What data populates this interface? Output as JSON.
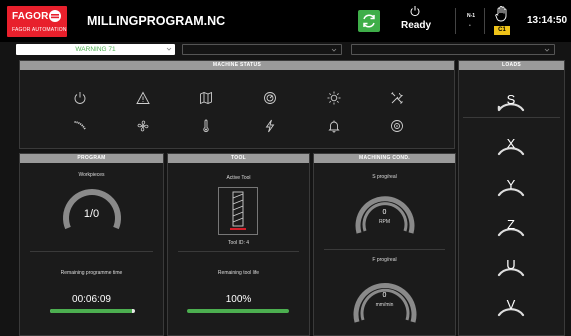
{
  "header": {
    "brand": "FAGOR",
    "brand_sub": "FAGOR AUTOMATION",
    "program_name": "MILLINGPROGRAM.NC",
    "status": "Ready",
    "channel": "N-1",
    "channel_badge": "C1",
    "time": "13:14:50"
  },
  "warnings": {
    "current": "WARNING 71"
  },
  "machine_status": {
    "title": "MACHINE STATUS",
    "icons": [
      "power-icon",
      "warning-triangle-icon",
      "map-icon",
      "gauge-icon",
      "sun-icon",
      "tools-icon",
      "hose-icon",
      "fan-icon",
      "thermometer-icon",
      "lightning-icon",
      "bell-icon",
      "spindle-icon"
    ]
  },
  "program": {
    "title": "PROGRAM",
    "workpieces_label": "Workpieces",
    "workpieces_value": "1/0",
    "remaining_label": "Remaining programme time",
    "remaining_value": "00:06:09",
    "remaining_progress": 0.96
  },
  "tool": {
    "title": "TOOL",
    "active_label": "Active Tool",
    "tool_id": "Tool ID: 4",
    "life_label": "Remaining tool life",
    "life_value": "100%",
    "life_progress": 1.0
  },
  "machining": {
    "title": "MACHINING COND.",
    "s_label": "S prog/real",
    "s_value": "0",
    "s_unit": "RPM",
    "f_label": "F prog/real",
    "f_value": "0",
    "f_unit": "mm/min"
  },
  "loads": {
    "title": "LOADS",
    "axes": [
      "S",
      "X",
      "Y",
      "Z",
      "U",
      "V"
    ]
  },
  "colors": {
    "brand": "#e8202c",
    "accent_green": "#3fae49",
    "warning_green": "#4caf50",
    "badge_yellow": "#f0c419",
    "panel_header": "#9a9a9a"
  }
}
